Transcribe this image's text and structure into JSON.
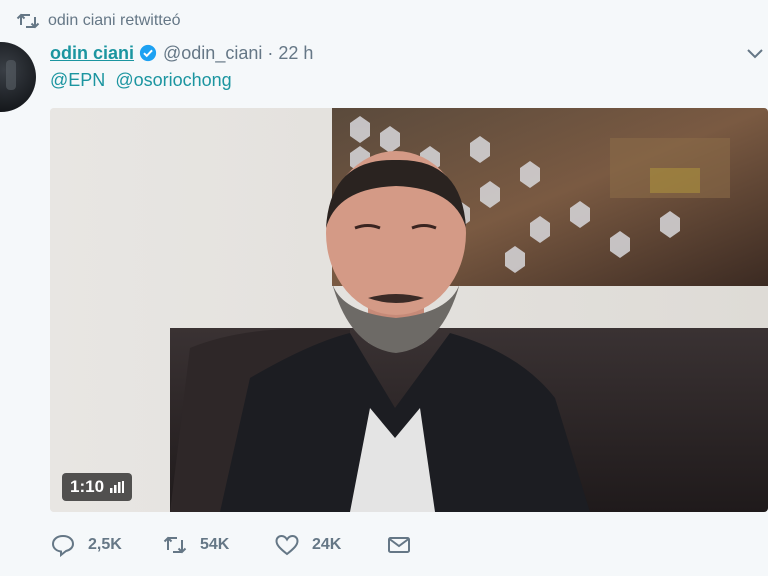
{
  "context": {
    "icon": "retweet-icon",
    "text": "odin ciani retwitteó"
  },
  "author": {
    "name": "odin ciani",
    "verified_icon": "verified-badge-icon",
    "handle": "@odin_ciani",
    "separator": "·",
    "time": "22 h"
  },
  "menu_icon": "chevron-down-icon",
  "text": {
    "mentions": [
      "@EPN",
      "@osoriochong"
    ]
  },
  "video": {
    "duration": "1:10",
    "volume_icon": "signal-bars-icon"
  },
  "actions": {
    "reply": {
      "icon": "reply-icon",
      "count": "2,5K"
    },
    "retweet": {
      "icon": "retweet-icon",
      "count": "54K"
    },
    "like": {
      "icon": "heart-icon",
      "count": "24K"
    },
    "message": {
      "icon": "envelope-icon"
    }
  },
  "colors": {
    "accent": "#1b95a0",
    "muted": "#657786",
    "verified": "#1da1f2",
    "background": "#f5f8fa"
  }
}
